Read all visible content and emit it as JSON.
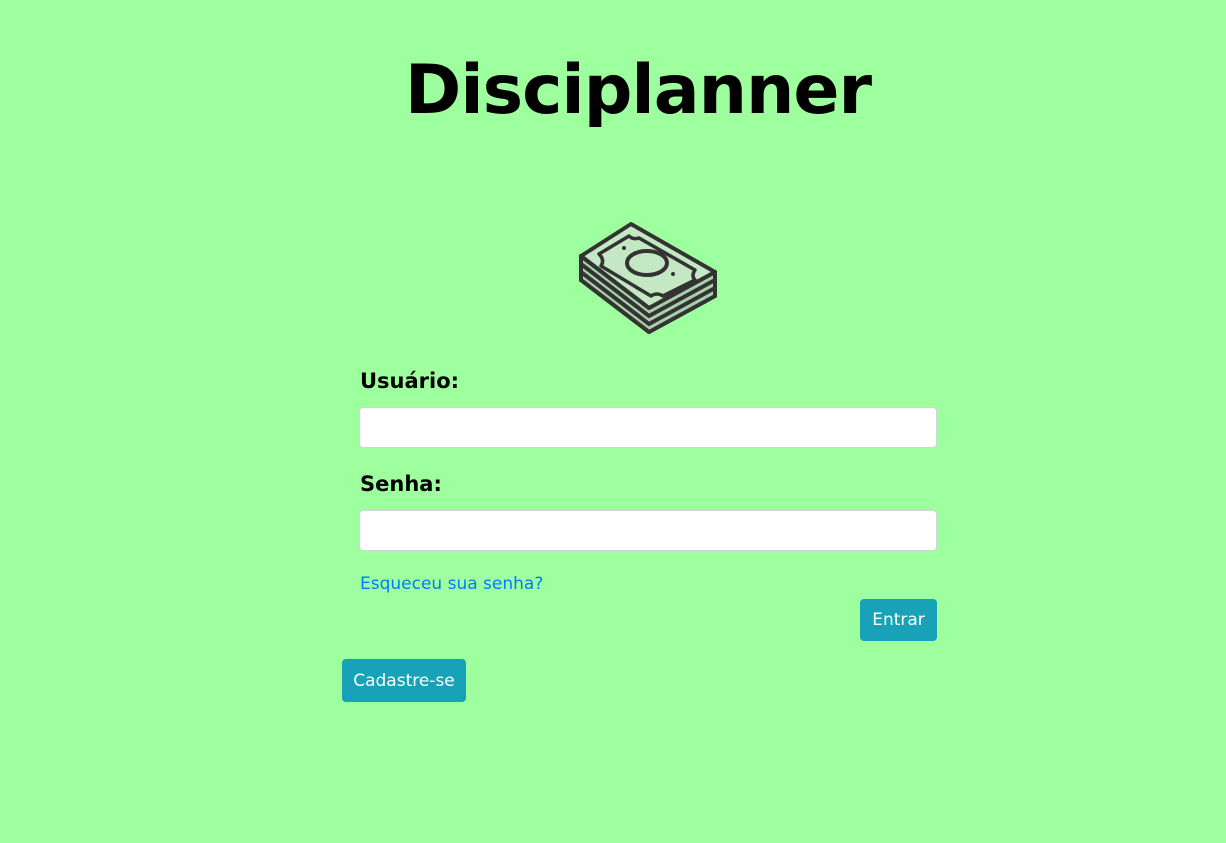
{
  "header": {
    "title": "Disciplanner"
  },
  "logo": {
    "icon": "money-stack-icon",
    "colors": {
      "outline": "#333333",
      "bill_light": "#c3e8c3",
      "bill_mid": "#a8cfa8"
    }
  },
  "login_form": {
    "user_label": "Usuário:",
    "user_value": "",
    "password_label": "Senha:",
    "password_value": "",
    "forgot_password_link": "Esqueceu sua senha?",
    "submit_label": "Entrar"
  },
  "register": {
    "button_label": "Cadastre-se"
  },
  "colors": {
    "background": "#9dff9d",
    "button": "#17a2b8",
    "link": "#007bff"
  }
}
